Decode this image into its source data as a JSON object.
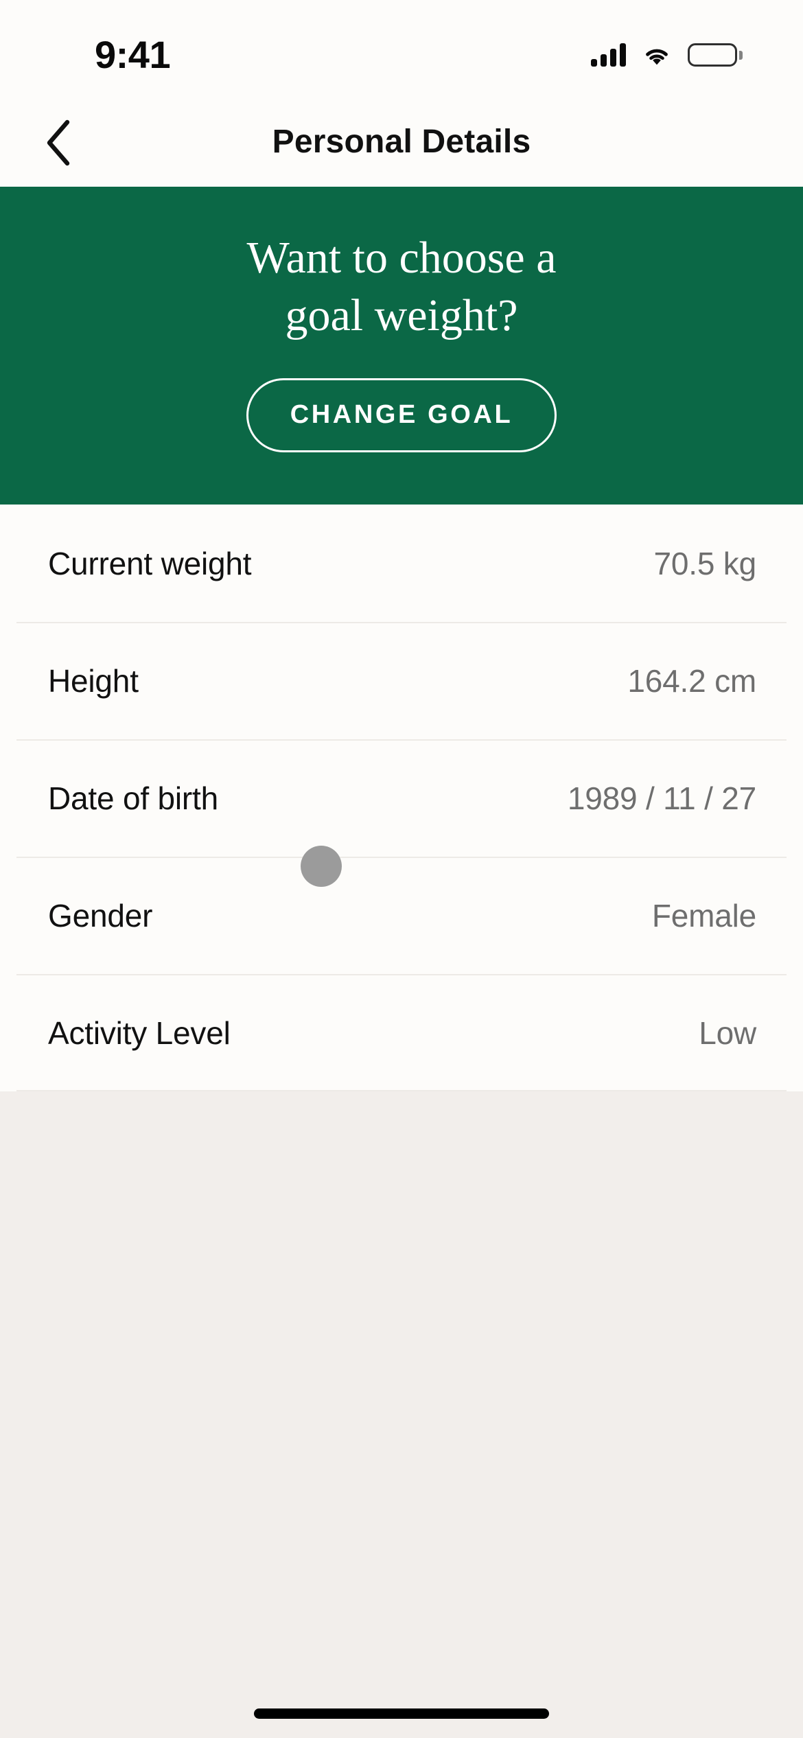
{
  "status_bar": {
    "time": "9:41",
    "signal_icon": "cellular-signal-icon",
    "wifi_icon": "wifi-icon",
    "battery_icon": "battery-full-icon"
  },
  "header": {
    "back_icon": "chevron-left-icon",
    "title": "Personal Details"
  },
  "promo": {
    "title_line1": "Want to choose a",
    "title_line2": "goal weight?",
    "button_label": "CHANGE GOAL",
    "background_color": "#0B6846",
    "text_color": "#FFFFFF"
  },
  "details": {
    "rows": [
      {
        "label": "Current weight",
        "value": "70.5 kg"
      },
      {
        "label": "Height",
        "value": "164.2 cm"
      },
      {
        "label": "Date of birth",
        "value": "1989 / 11 / 27"
      },
      {
        "label": "Gender",
        "value": "Female"
      },
      {
        "label": "Activity Level",
        "value": "Low"
      }
    ]
  },
  "overlay": {
    "touch_indicator": "tap-indicator",
    "touch_color": "#9B9B9B"
  },
  "system": {
    "home_indicator": "home-indicator"
  },
  "colors": {
    "page_background": "#F2EEEB",
    "surface": "#FDFCFA",
    "brand_green": "#0B6846",
    "label_text": "#111111",
    "value_text": "#6E6E6E",
    "divider": "#EDEAE6"
  }
}
